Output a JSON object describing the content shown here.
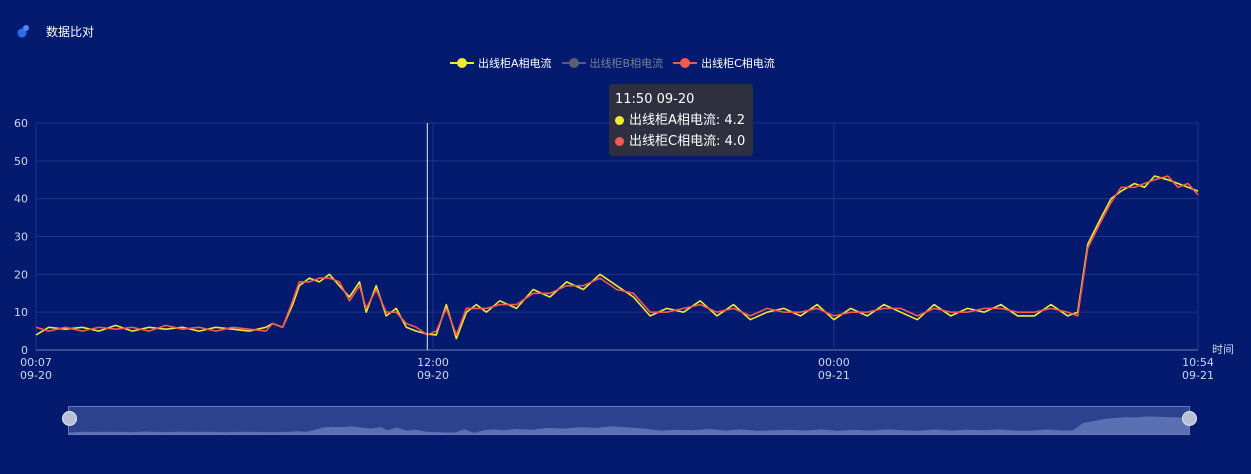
{
  "header": {
    "icon": "pin-icon",
    "title": "数据比对"
  },
  "colors": {
    "background": "#031a6e",
    "seriesA": "#f0ea30",
    "seriesB": "#5a5e72",
    "seriesC": "#f55a4e",
    "grid": "#1f3585",
    "axis_text": "#cfd6ee"
  },
  "legend": [
    {
      "name": "出线柜A相电流",
      "color": "#f0ea30",
      "active": true
    },
    {
      "name": "出线柜B相电流",
      "color": "#5a5e72",
      "active": false
    },
    {
      "name": "出线柜C相电流",
      "color": "#f55a4e",
      "active": true
    }
  ],
  "tooltip": {
    "title": "11:50 09-20",
    "rows": [
      {
        "label": "出线柜A相电流: 4.2",
        "color": "#f0ea30"
      },
      {
        "label": "出线柜C相电流: 4.0",
        "color": "#f55a4e"
      }
    ]
  },
  "chart_data": {
    "type": "line",
    "title": "数据比对",
    "xlabel": "时间",
    "ylabel": "",
    "ylim": [
      0,
      60
    ],
    "yticks": [
      0,
      10,
      20,
      30,
      40,
      50,
      60
    ],
    "xlim_hours": [
      0.117,
      34.9
    ],
    "xticks": [
      {
        "h": 0.117,
        "line1": "00:07",
        "line2": "09-20"
      },
      {
        "h": 12,
        "line1": "12:00",
        "line2": "09-20"
      },
      {
        "h": 24,
        "line1": "00:00",
        "line2": "09-21"
      },
      {
        "h": 34.9,
        "line1": "10:54",
        "line2": "09-21"
      }
    ],
    "cursor_hour": 11.83,
    "grid": true,
    "legend_position": "top-center",
    "x_hours": [
      0.12,
      0.5,
      1,
      1.5,
      2,
      2.5,
      3,
      3.5,
      4,
      4.5,
      5,
      5.5,
      6,
      6.5,
      7,
      7.2,
      7.5,
      7.8,
      8,
      8.3,
      8.6,
      8.9,
      9.2,
      9.5,
      9.8,
      10,
      10.3,
      10.6,
      10.9,
      11.2,
      11.5,
      11.83,
      12.1,
      12.4,
      12.7,
      13,
      13.3,
      13.6,
      14,
      14.5,
      15,
      15.5,
      16,
      16.5,
      17,
      17.5,
      18,
      18.5,
      19,
      19.5,
      20,
      20.5,
      21,
      21.5,
      22,
      22.5,
      23,
      23.5,
      24,
      24.5,
      25,
      25.5,
      26,
      26.5,
      27,
      27.5,
      28,
      28.5,
      29,
      29.5,
      30,
      30.5,
      31,
      31.3,
      31.6,
      32,
      32.3,
      32.6,
      33,
      33.3,
      33.6,
      34,
      34.3,
      34.6,
      34.9
    ],
    "series": [
      {
        "name": "出线柜A相电流",
        "values": [
          4,
          6,
          5.5,
          6,
          5,
          6.5,
          5,
          6,
          5.5,
          6,
          5,
          6,
          5.5,
          5,
          6,
          7,
          6,
          12,
          17,
          19,
          18,
          20,
          17,
          14,
          18,
          10,
          17,
          9,
          11,
          6,
          5,
          4.2,
          4,
          12,
          3,
          10,
          12,
          10,
          13,
          11,
          16,
          14,
          18,
          16,
          20,
          17,
          14,
          9,
          11,
          10,
          13,
          9,
          12,
          8,
          10,
          11,
          9,
          12,
          8,
          11,
          9,
          12,
          10,
          8,
          12,
          9,
          11,
          10,
          12,
          9,
          9,
          12,
          9,
          10,
          28,
          35,
          40,
          42,
          44,
          43,
          46,
          45,
          44,
          43,
          42
        ],
        "tt": ""
      },
      {
        "name": "出线柜C相电流",
        "values": [
          6,
          5,
          6,
          5,
          6,
          5.5,
          6,
          5,
          6.5,
          5.5,
          6,
          5,
          6,
          5.5,
          5,
          7,
          6,
          13,
          18,
          18,
          19,
          19,
          18,
          13,
          17,
          11,
          16,
          10,
          10,
          7,
          6,
          4,
          5,
          11,
          4,
          11,
          11,
          11,
          12,
          12,
          15,
          15,
          17,
          17,
          19,
          16,
          15,
          10,
          10,
          11,
          12,
          10,
          11,
          9,
          11,
          10,
          10,
          11,
          9,
          10,
          10,
          11,
          11,
          9,
          11,
          10,
          10,
          11,
          11,
          10,
          10,
          11,
          10,
          9,
          27,
          34,
          39,
          43,
          43,
          44,
          45,
          46,
          43,
          44,
          41
        ]
      }
    ]
  },
  "zoom": {
    "start_pct": 0,
    "end_pct": 100
  }
}
